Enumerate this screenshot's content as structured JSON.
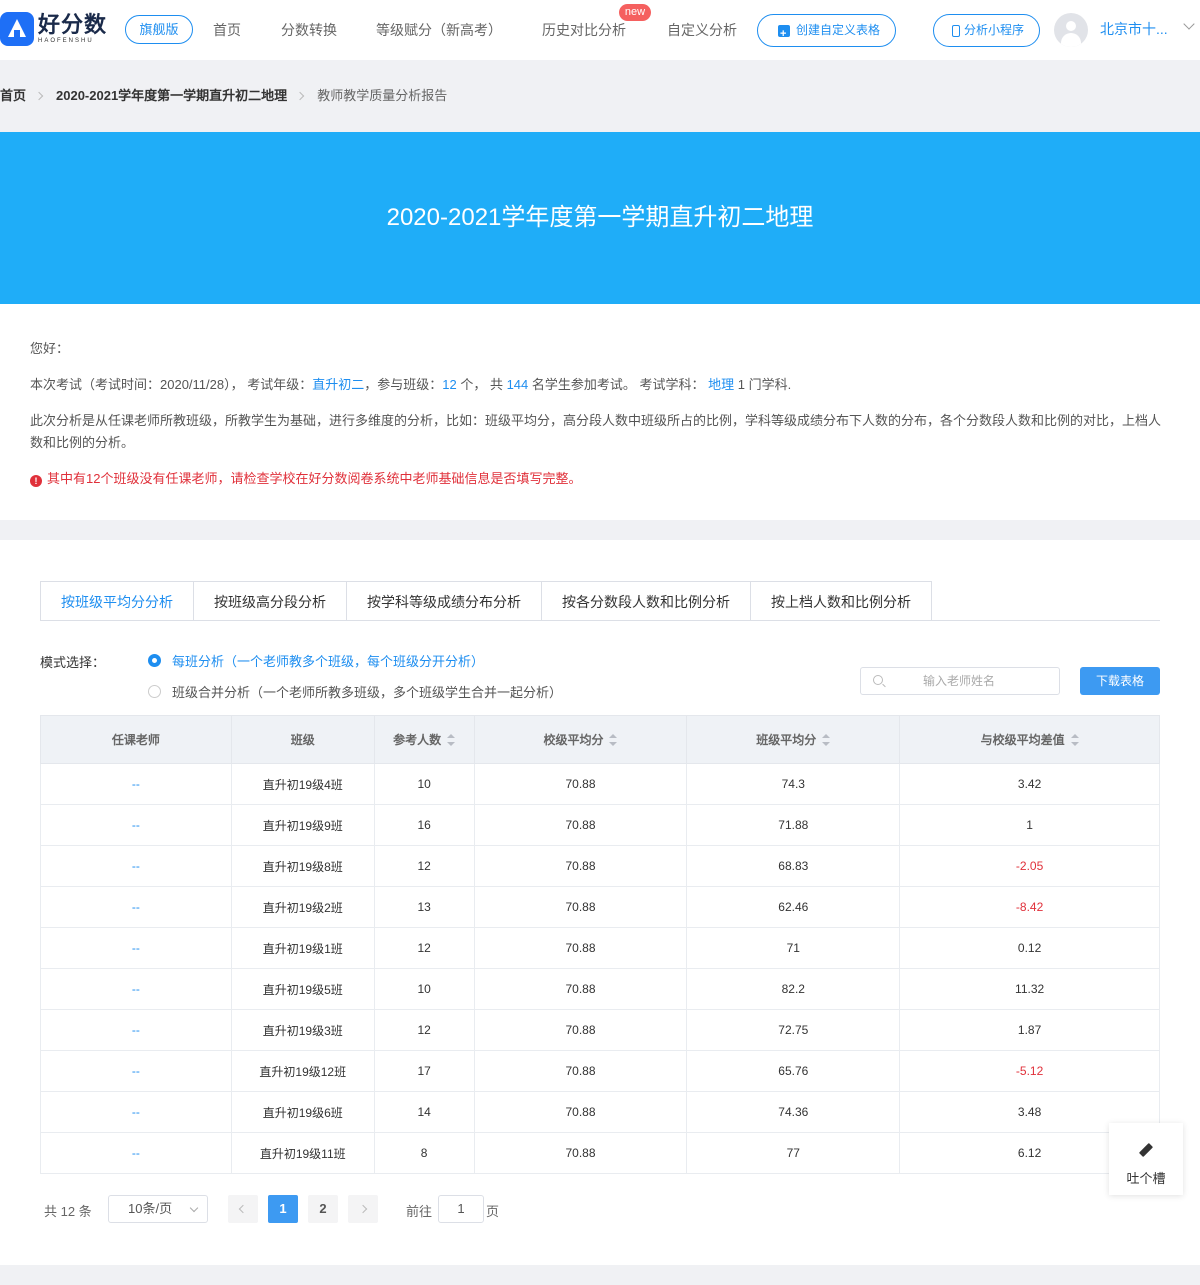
{
  "brand": {
    "name_cn": "好分数",
    "name_en": "HAOFENSHU",
    "edition": "旗舰版"
  },
  "nav": {
    "items": [
      "首页",
      "分数转换",
      "等级赋分（新高考）",
      "历史对比分析",
      "自定义分析"
    ],
    "new_badge": "new",
    "create_button": "创建自定义表格",
    "mini_program_button": "分析小程序",
    "user_name": "北京市十..."
  },
  "breadcrumb": {
    "home": "首页",
    "exam": "2020-2021学年度第一学期直升初二地理",
    "current": "教师教学质量分析报告"
  },
  "banner": {
    "title": "2020-2021学年度第一学期直升初二地理"
  },
  "intro": {
    "greeting": "您好：",
    "exam_prefix": "本次考试（考试时间：2020/11/28），  考试年级：",
    "grade": "直升初二",
    "class_prefix": "，参与班级：",
    "class_count": "12",
    "student_prefix": " 个，  共 ",
    "student_count": "144",
    "subject_prefix": " 名学生参加考试。  考试学科：  ",
    "subject": "地理",
    "subject_suffix": " 1 门学科.",
    "desc": "此次分析是从任课老师所教班级，所教学生为基础，进行多维度的分析，比如：班级平均分，高分段人数中班级所占的比例，学科等级成绩分布下人数的分布，各个分数段人数和比例的对比，上档人数和比例的分析。",
    "warning": "其中有12个班级没有任课老师，请检查学校在好分数阅卷系统中老师基础信息是否填写完整。"
  },
  "tabs": [
    "按班级平均分分析",
    "按班级高分段分析",
    "按学科等级成绩分布分析",
    "按各分数段人数和比例分析",
    "按上档人数和比例分析"
  ],
  "mode": {
    "label": "模式选择：",
    "options": [
      "每班分析（一个老师教多个班级，每个班级分开分析）",
      "班级合并分析（一个老师所教多班级，多个班级学生合并一起分析）"
    ],
    "selected": 0
  },
  "search": {
    "placeholder": "输入老师姓名"
  },
  "download_button": "下载表格",
  "table": {
    "headers": [
      "任课老师",
      "班级",
      "参考人数",
      "校级平均分",
      "班级平均分",
      "与校级平均差值"
    ],
    "rows": [
      [
        "--",
        "直升初19级4班",
        "10",
        "70.88",
        "74.3",
        "3.42"
      ],
      [
        "--",
        "直升初19级9班",
        "16",
        "70.88",
        "71.88",
        "1"
      ],
      [
        "--",
        "直升初19级8班",
        "12",
        "70.88",
        "68.83",
        "-2.05"
      ],
      [
        "--",
        "直升初19级2班",
        "13",
        "70.88",
        "62.46",
        "-8.42"
      ],
      [
        "--",
        "直升初19级1班",
        "12",
        "70.88",
        "71",
        "0.12"
      ],
      [
        "--",
        "直升初19级5班",
        "10",
        "70.88",
        "82.2",
        "11.32"
      ],
      [
        "--",
        "直升初19级3班",
        "12",
        "70.88",
        "72.75",
        "1.87"
      ],
      [
        "--",
        "直升初19级12班",
        "17",
        "70.88",
        "65.76",
        "-5.12"
      ],
      [
        "--",
        "直升初19级6班",
        "14",
        "70.88",
        "74.36",
        "3.48"
      ],
      [
        "--",
        "直升初19级11班",
        "8",
        "70.88",
        "77",
        "6.12"
      ]
    ]
  },
  "pagination": {
    "total": "共 12 条",
    "page_size": "10条/页",
    "pages": [
      "1",
      "2"
    ],
    "current": "1",
    "goto_label": "前往",
    "goto_value": "1",
    "goto_unit": "页"
  },
  "feedback": {
    "label": "吐个槽"
  },
  "colors": {
    "primary": "#1e8ef0",
    "banner": "#1fadf8",
    "negative": "#e0303a",
    "new_badge": "#f5605f"
  }
}
